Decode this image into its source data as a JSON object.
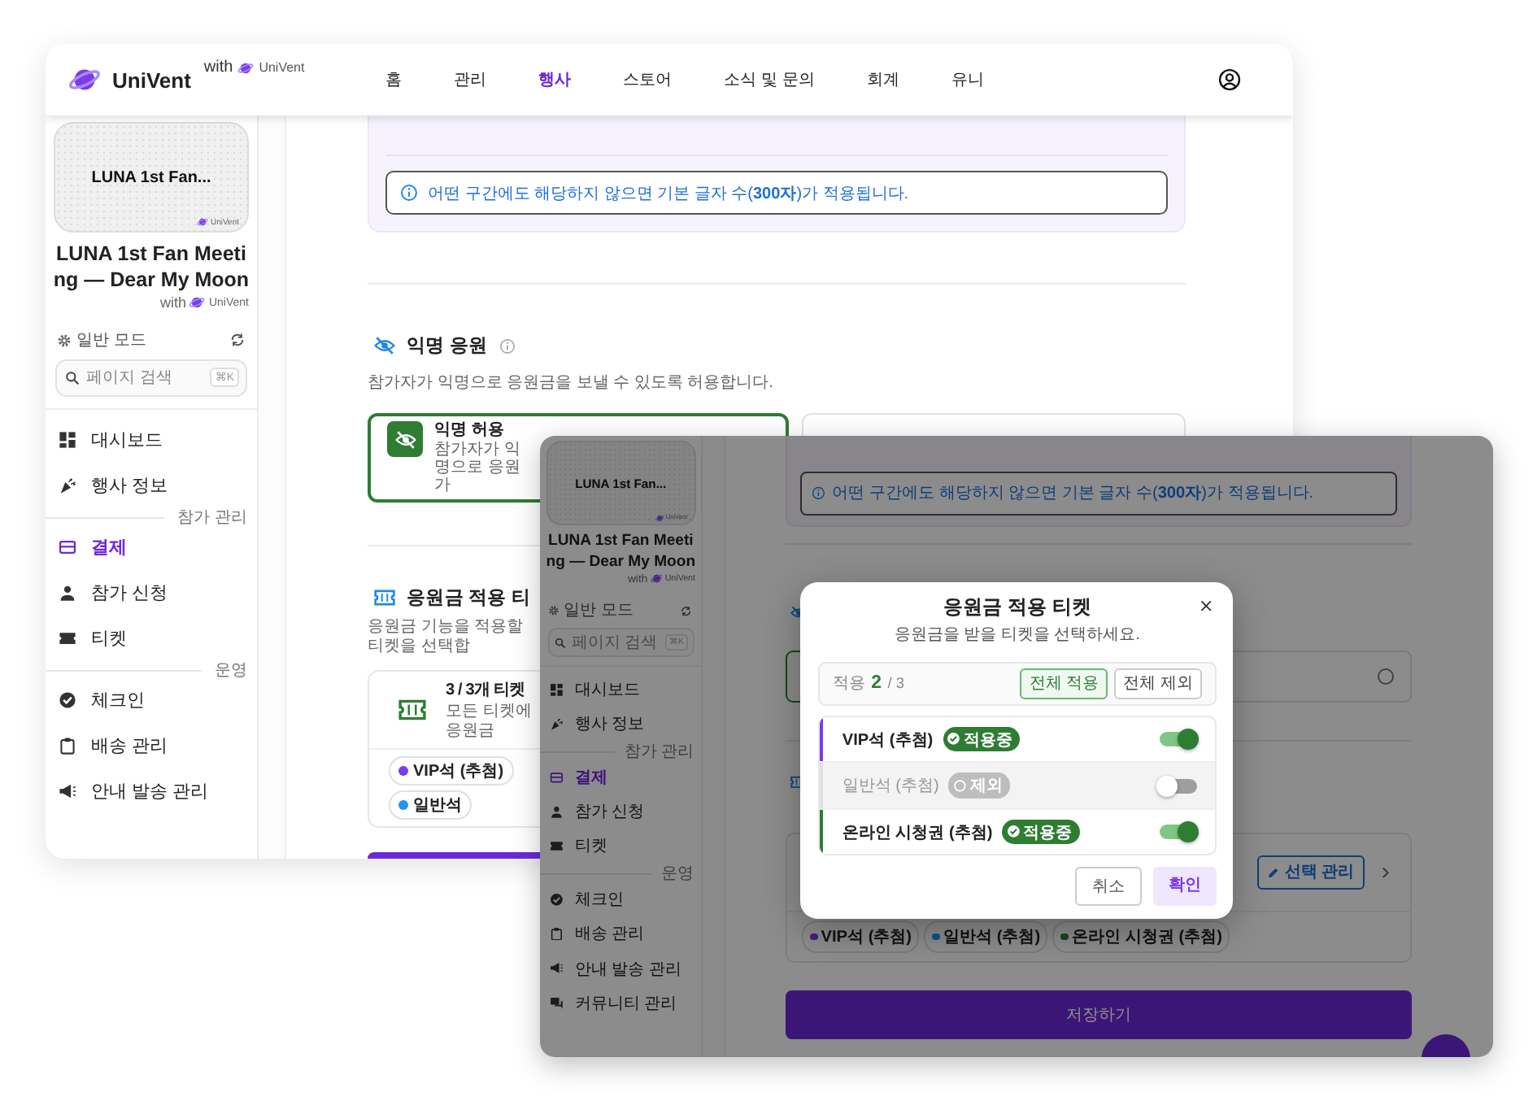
{
  "back_window": {
    "nav": {
      "logo": "UniVent",
      "with_label": "with",
      "partner": "UniVent",
      "items": [
        {
          "label": "홈",
          "selected": false
        },
        {
          "label": "관리",
          "selected": false
        },
        {
          "label": "행사",
          "selected": true
        },
        {
          "label": "스토어",
          "selected": false
        },
        {
          "label": "소식 및 문의",
          "selected": false
        },
        {
          "label": "회계",
          "selected": false
        },
        {
          "label": "유니",
          "selected": false
        }
      ]
    },
    "sidebar": {
      "thumbnail_title": "LUNA 1st Fan...",
      "thumbnail_brand": "UniVent",
      "event_title": "LUNA 1st Fan Meeting — Dear My Moon",
      "with_label": "with",
      "brand": "UniVent",
      "mode": "일반 모드",
      "search_placeholder": "페이지 검색",
      "shortcut": "⌘K",
      "sections": [
        {
          "items": [
            {
              "label": "대시보드",
              "selected": false
            },
            {
              "label": "행사 정보",
              "selected": false
            }
          ]
        },
        {
          "label": "참가 관리",
          "items": [
            {
              "label": "결제",
              "selected": true
            },
            {
              "label": "참가 신청",
              "selected": false
            },
            {
              "label": "티켓",
              "selected": false
            }
          ]
        },
        {
          "label": "운영",
          "items": [
            {
              "label": "체크인",
              "selected": false
            },
            {
              "label": "배송 관리",
              "selected": false
            },
            {
              "label": "안내 발송 관리",
              "selected": false
            }
          ]
        }
      ]
    },
    "notice": "어떤 구간에도 해당하지 않으면 기본 글자 수(**300자**)가 적용됩니다.",
    "anonymous": {
      "title": "익명 응원",
      "description": "참가자가 익명으로 응원금을 보낼 수 있도록 허용합니다.",
      "option": {
        "title": "익명 허용",
        "description": "참가자가 익명으로 응원 가",
        "selected": true
      }
    },
    "tickets_section": {
      "title": "응원금 적용 티",
      "description": "응원금 기능을 적용할 티켓을 선택합",
      "summary_title": "3 / 3개 티켓",
      "summary_description": "모든 티켓에 응원금",
      "chips": [
        {
          "label": "VIP석 (추첨)",
          "color": "#7c3aed"
        },
        {
          "label": "일반석",
          "color": "#2196f3"
        }
      ]
    }
  },
  "front_window": {
    "sidebar": {
      "thumbnail_title": "LUNA 1st Fan...",
      "thumbnail_brand": "UniVent",
      "event_title": "LUNA 1st Fan Meeting — Dear My Moon",
      "with_label": "with",
      "brand": "UniVent",
      "mode": "일반 모드",
      "search_placeholder": "페이지 검색",
      "shortcut": "⌘K",
      "sections": [
        {
          "items": [
            {
              "label": "대시보드",
              "selected": false
            },
            {
              "label": "행사 정보",
              "selected": false
            }
          ]
        },
        {
          "label": "참가 관리",
          "items": [
            {
              "label": "결제",
              "selected": true
            },
            {
              "label": "참가 신청",
              "selected": false
            },
            {
              "label": "티켓",
              "selected": false
            }
          ]
        },
        {
          "label": "운영",
          "items": [
            {
              "label": "체크인",
              "selected": false
            },
            {
              "label": "배송 관리",
              "selected": false
            },
            {
              "label": "안내 발송 관리",
              "selected": false
            },
            {
              "label": "커뮤니티 관리",
              "selected": false
            }
          ]
        }
      ]
    },
    "notice": "어떤 구간에도 해당하지 않으면 기본 글자 수(**300자**)가 적용됩니다.",
    "options": [
      {
        "selected": true
      },
      {
        "selected": false
      }
    ],
    "manage_button": "선택 관리",
    "chips": [
      {
        "label": "VIP석 (추첨)",
        "color": "#442082"
      },
      {
        "label": "일반석 (추첨)",
        "color": "#125386"
      },
      {
        "label": "온라인 시청권 (추첨)",
        "color": "#19451c"
      }
    ],
    "save_button": "저장하기",
    "modal": {
      "title": "응원금 적용 티켓",
      "subtitle": "응원금을 받을 티켓을 선택하세요.",
      "count_label": "적용",
      "count": "2",
      "total": "/ 3",
      "bulk_actions": [
        {
          "label": "전체 적용",
          "selected": true
        },
        {
          "label": "전체 제외",
          "selected": false
        }
      ],
      "tickets": [
        {
          "name": "VIP석 (추첨)",
          "badge": "적용중",
          "on": true,
          "color": "#7c3aed"
        },
        {
          "name": "일반석 (추첨)",
          "badge": "제외",
          "on": false,
          "color": "#e0e0e0"
        },
        {
          "name": "온라인 시청권 (추첨)",
          "badge": "적용중",
          "on": true,
          "color": "#2e7d32"
        }
      ],
      "buttons": [
        {
          "label": "취소",
          "kind": "secondary"
        },
        {
          "label": "확인",
          "kind": "primary"
        }
      ]
    }
  }
}
